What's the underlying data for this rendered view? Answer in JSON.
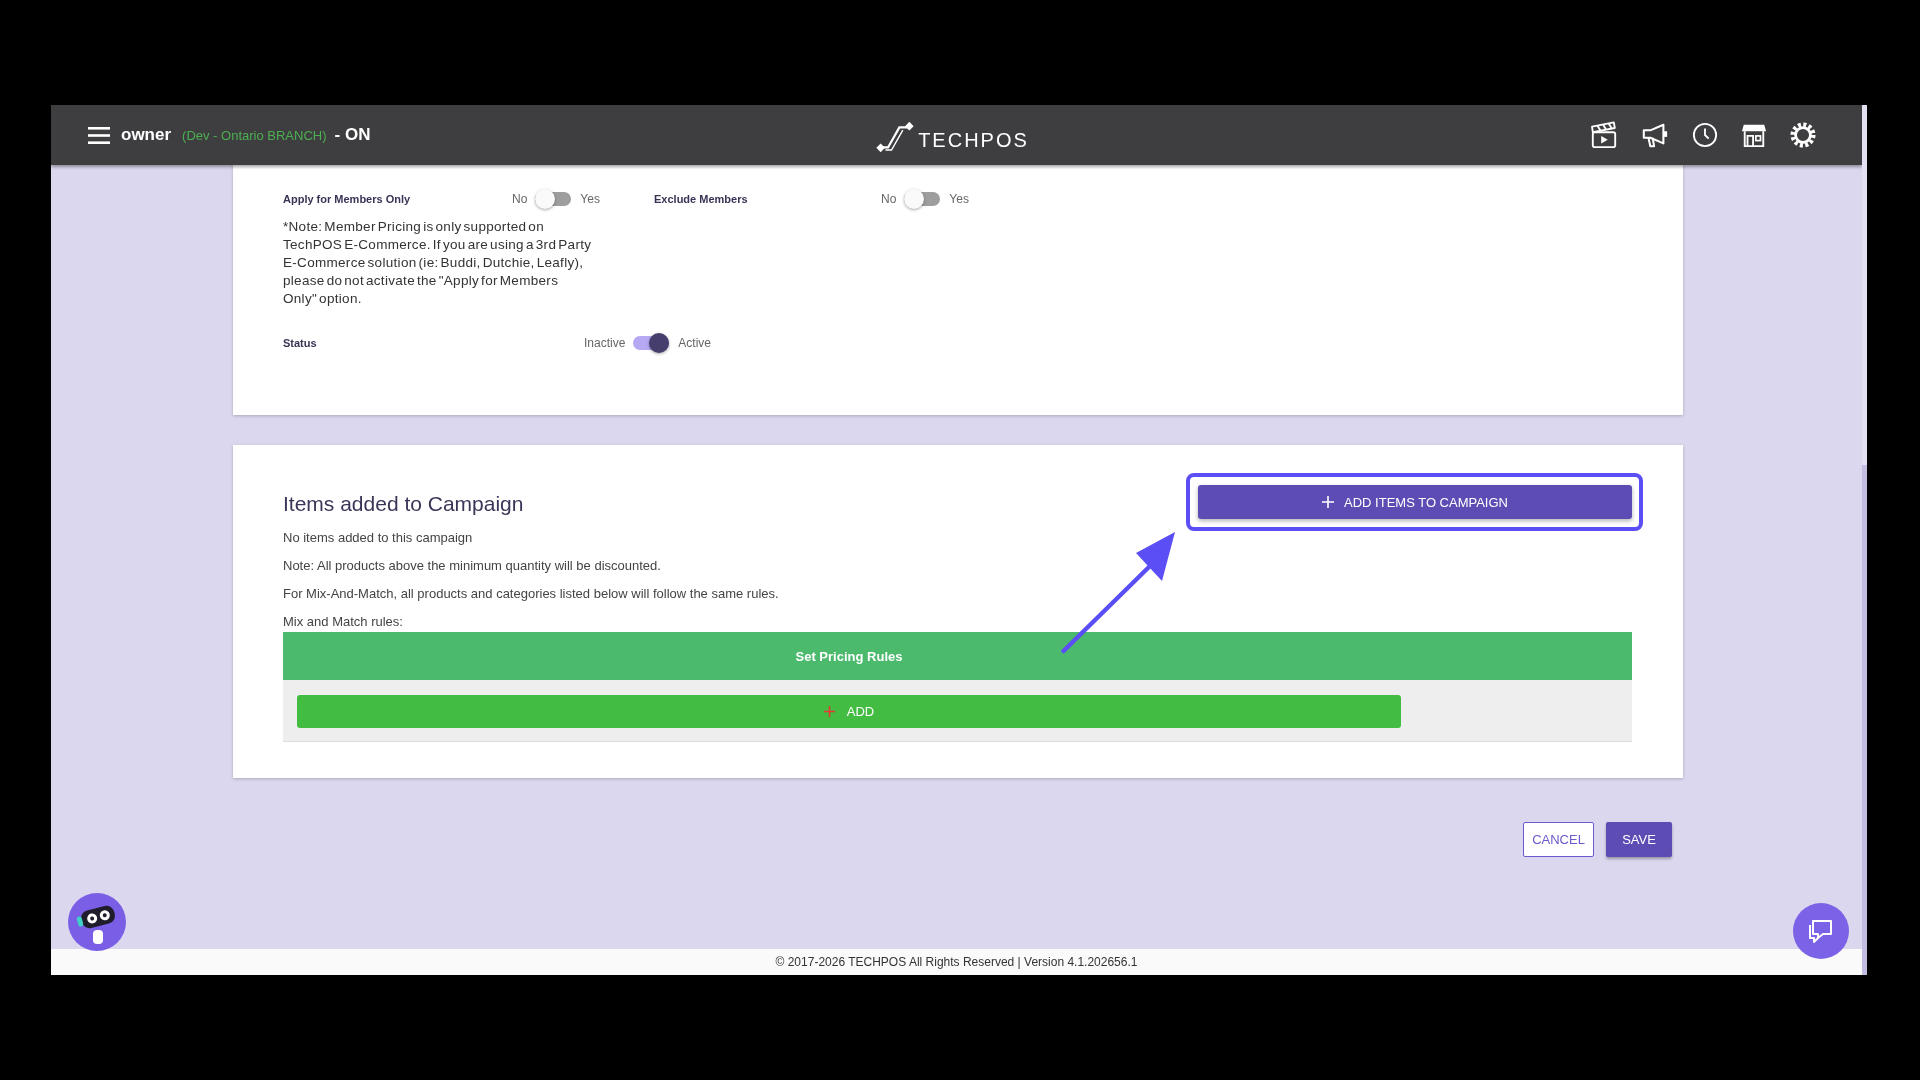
{
  "header": {
    "user": "owner",
    "branch": "(Dev - Ontario BRANCH)",
    "mode": "- ON",
    "logo": "TECHPOS"
  },
  "settings": {
    "member_options": [
      {
        "label": "Apply for Members Only",
        "off_label": "No",
        "on_label": "Yes",
        "on": false
      },
      {
        "label": "Exclude Members",
        "off_label": "No",
        "on_label": "Yes",
        "on": false
      }
    ],
    "note": "*Note: Member Pricing is only supported on TechPOS E-Commerce. If you are using a 3rd Party E-Commerce solution (ie: Buddi, Dutchie, Leafly), please do not activate the \"Apply for Members Only\" option.",
    "status": {
      "label": "Status",
      "off_label": "Inactive",
      "on_label": "Active",
      "on": true
    }
  },
  "items": {
    "title": "Items added to Campaign",
    "add_items_button": "ADD ITEMS TO CAMPAIGN",
    "notes": [
      "No items added to this campaign",
      "Note: All products above the minimum quantity will be discounted.",
      "For Mix-And-Match, all products and categories listed below will follow the same rules.",
      "Mix and Match rules:"
    ],
    "rules_header": "Set Pricing Rules",
    "add_button": "ADD"
  },
  "actions": [
    {
      "label": "CANCEL",
      "kind": "outline"
    },
    {
      "label": "SAVE",
      "kind": "filled"
    }
  ],
  "footer": "© 2017-2026 TECHPOS All Rights Reserved | Version 4.1.202656.1"
}
